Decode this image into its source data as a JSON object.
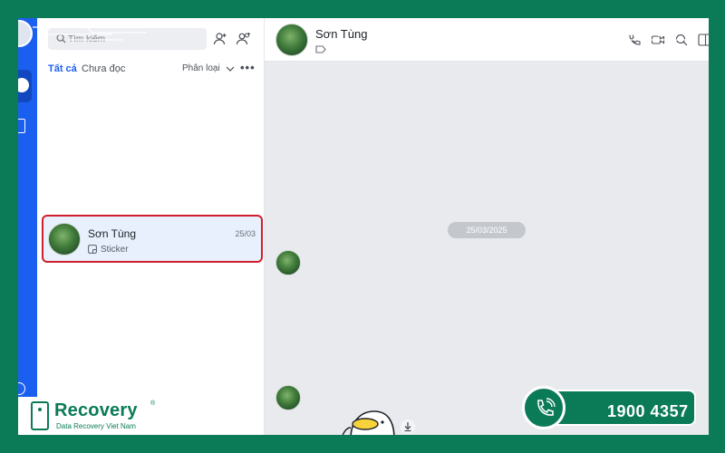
{
  "search": {
    "placeholder": "Tìm kiếm"
  },
  "list": {
    "tabs": [
      {
        "label": "Tất cả",
        "active": true
      },
      {
        "label": "Chưa đọc",
        "active": false
      }
    ],
    "filter_label": "Phân loại",
    "more_label": "•••",
    "conversations": [
      {
        "name": "Sơn Tùng",
        "time": "25/03",
        "preview": "Sticker",
        "selected": true
      }
    ]
  },
  "chat": {
    "contact_name": "Sơn Tùng",
    "date_separator": "25/03/2025",
    "header_icons": [
      "phone-icon",
      "video-icon",
      "search-icon",
      "sidebar-toggle-icon"
    ]
  },
  "branding": {
    "brand": "Recovery",
    "registered": "®",
    "tagline": "Data Recovery Viet Nam",
    "hotline": "1900 4357"
  },
  "colors": {
    "frame": "#0b7a57",
    "rail": "#1a5ff0",
    "highlight": "#d11e2d",
    "selected_bg": "#e8f0fd",
    "chat_bg": "#e8eaed"
  }
}
